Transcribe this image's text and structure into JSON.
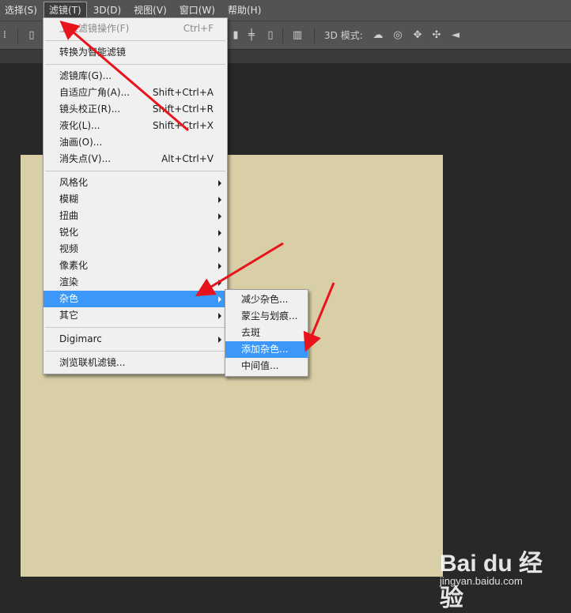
{
  "menubar": {
    "items": [
      {
        "label": "选择(S)"
      },
      {
        "label": "滤镜(T)",
        "active": true
      },
      {
        "label": "3D(D)"
      },
      {
        "label": "视图(V)"
      },
      {
        "label": "窗口(W)"
      },
      {
        "label": "帮助(H)"
      }
    ]
  },
  "optbar": {
    "mode_label": "3D 模式:"
  },
  "filter_menu": {
    "last_filter": {
      "label": "上次滤镜操作(F)",
      "shortcut": "Ctrl+F"
    },
    "convert_smart": {
      "label": "转换为智能滤镜"
    },
    "gallery": {
      "label": "滤镜库(G)..."
    },
    "adaptive_wide": {
      "label": "自适应广角(A)...",
      "shortcut": "Shift+Ctrl+A"
    },
    "lens_correction": {
      "label": "镜头校正(R)...",
      "shortcut": "Shift+Ctrl+R"
    },
    "liquify": {
      "label": "液化(L)...",
      "shortcut": "Shift+Ctrl+X"
    },
    "oil_paint": {
      "label": "油画(O)..."
    },
    "vanishing_point": {
      "label": "消失点(V)...",
      "shortcut": "Alt+Ctrl+V"
    },
    "stylize": {
      "label": "风格化"
    },
    "blur": {
      "label": "模糊"
    },
    "distort": {
      "label": "扭曲"
    },
    "sharpen": {
      "label": "锐化"
    },
    "video": {
      "label": "视频"
    },
    "pixelate": {
      "label": "像素化"
    },
    "render": {
      "label": "渲染"
    },
    "noise": {
      "label": "杂色"
    },
    "other": {
      "label": "其它"
    },
    "digimarc": {
      "label": "Digimarc"
    },
    "browse_online": {
      "label": "浏览联机滤镜..."
    }
  },
  "noise_menu": {
    "reduce_noise": {
      "label": "减少杂色..."
    },
    "dust_scratches": {
      "label": "蒙尘与划痕..."
    },
    "despeckle": {
      "label": "去斑"
    },
    "add_noise": {
      "label": "添加杂色..."
    },
    "median": {
      "label": "中间值..."
    }
  },
  "colors": {
    "menubar_bg": "#535353",
    "canvas": "#d9cfa7",
    "highlight": "#3c98f8",
    "annotation_arrow": "#e8131b"
  },
  "watermark": {
    "logo": "Bai du 经验",
    "url": "jingyan.baidu.com"
  }
}
